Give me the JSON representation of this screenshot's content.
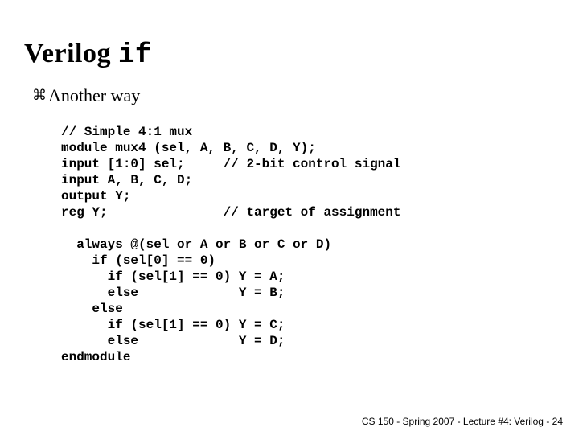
{
  "title": {
    "part1": "Verilog ",
    "part2": "if"
  },
  "bullet_glyph": "⌘",
  "subtitle": "Another way",
  "code": "// Simple 4:1 mux\nmodule mux4 (sel, A, B, C, D, Y);\ninput [1:0] sel;     // 2-bit control signal\ninput A, B, C, D;\noutput Y;\nreg Y;               // target of assignment\n\n  always @(sel or A or B or C or D)\n    if (sel[0] == 0)\n      if (sel[1] == 0) Y = A;\n      else             Y = B;\n    else\n      if (sel[1] == 0) Y = C;\n      else             Y = D;\nendmodule",
  "footer": "CS 150 - Spring 2007 - Lecture #4: Verilog - 24"
}
